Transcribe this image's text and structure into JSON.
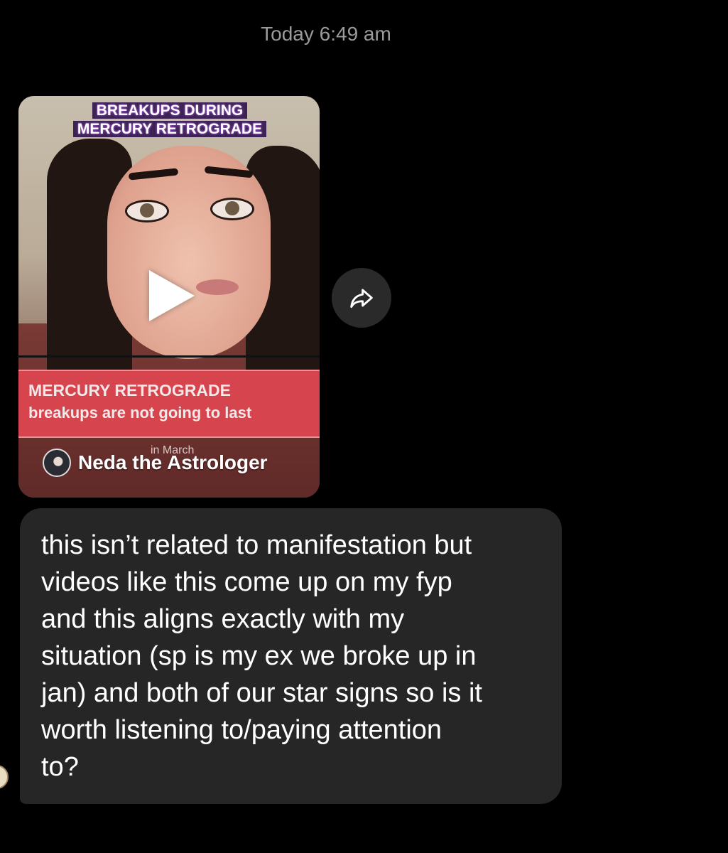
{
  "header": {
    "timestamp": "Today 6:49 am"
  },
  "shared_video": {
    "headline": "BREAKUPS DURING MERCURY RETROGRADE",
    "caption_title": "MERCURY RETROGRADE",
    "caption_subtitle": "breakups are not going to last",
    "caption_fragment": "in March",
    "creator_name": "Neda the Astrologer",
    "play_icon": "play-icon",
    "share_icon": "share-arrow-icon"
  },
  "message": {
    "text": "this isn’t related to manifestation but\nvideos like this come up on my fyp\nand this aligns exactly with my\nsituation (sp is my ex we broke up in\njan) and both of our star signs so is it\nworth listening to/paying attention\nto?"
  },
  "colors": {
    "background": "#000000",
    "bubble": "#262626",
    "caption_band": "#d6454e",
    "headline_band": "#3c2354"
  }
}
